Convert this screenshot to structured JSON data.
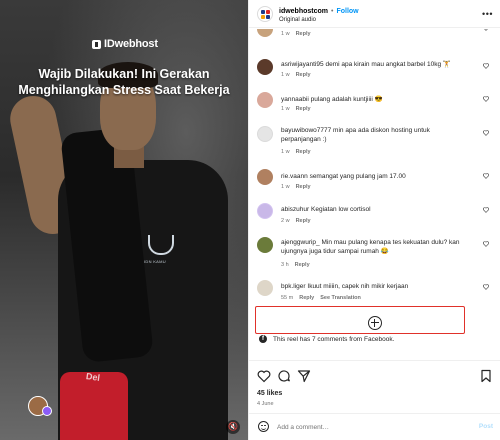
{
  "media": {
    "brand": "IDwebhost",
    "caption_line1": "Wajib Dilakukan! Ini Gerakan",
    "caption_line2": "Menghilangkan Stress Saat Bekerja",
    "shirt_logo_text": "IDN KAMU",
    "stool_text": "Del"
  },
  "header": {
    "account_name": "idwebhostcom",
    "dot": "•",
    "follow_label": "Follow",
    "audio_label": "Original audio",
    "more_label": "•••"
  },
  "comments": [
    {
      "time": "1 w",
      "reply": "Reply",
      "text": ""
    },
    {
      "user": "asriwijayanti95",
      "text": "demi apa kirain mau angkat barbel 10kg 🏋️",
      "time": "1 w",
      "reply": "Reply"
    },
    {
      "user": "yannaabii",
      "text": "pulang adalah kuntjiiii 😎",
      "time": "1 w",
      "reply": "Reply"
    },
    {
      "user": "bayuwibowo7777",
      "text": "min apa ada diskon hosting untuk perpanjangan :)",
      "time": "1 w",
      "reply": "Reply"
    },
    {
      "user": "rie.vaann",
      "text": "semangat yang pulang jam 17.00",
      "time": "1 w",
      "reply": "Reply"
    },
    {
      "user": "abiszuhur",
      "text": "Kegiatan low cortisol",
      "time": "2 w",
      "reply": "Reply"
    },
    {
      "user": "ajenggwurip_",
      "text": "Min mau pulang kenapa tes kekuatan dulu? kan ujungnya juga tidur sampai rumah 😂",
      "time": "3 h",
      "reply": "Reply"
    },
    {
      "user": "bpk.liger",
      "text": "Ikuut miiiin, capek nih mikir kerjaan",
      "time": "55 m",
      "reply": "Reply",
      "see_translation": "See Translation"
    }
  ],
  "fb_note": "This reel has 7 comments from Facebook.",
  "likes": "45 likes",
  "date": "4 June",
  "add_comment": {
    "placeholder": "Add a comment…",
    "post_label": "Post"
  },
  "colors": {
    "follow_blue": "#0095f6",
    "highlight_red": "#e0312a",
    "post_disabled": "#b2dffc"
  }
}
